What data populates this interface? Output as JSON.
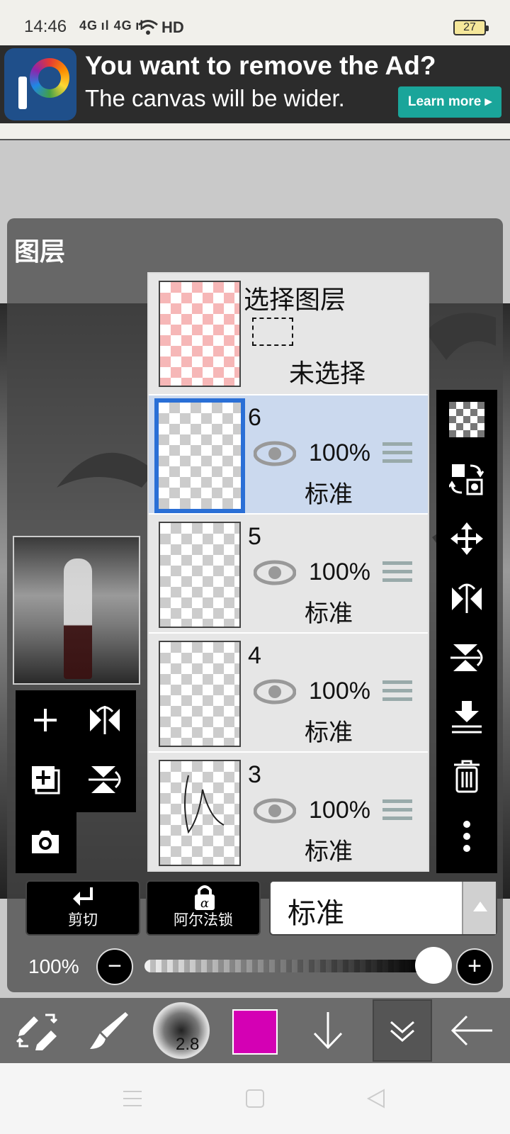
{
  "status": {
    "time": "14:46",
    "signal": "4G ıl 4G ıl",
    "network": "HD",
    "battery": "27"
  },
  "ad": {
    "title": "You want to remove the Ad?",
    "subtitle": "The canvas will be wider.",
    "button": "Learn more ▸"
  },
  "panel": {
    "title": "图层",
    "selection": {
      "title": "选择图层",
      "status": "未选择"
    },
    "layers": [
      {
        "number": "6",
        "opacity": "100%",
        "mode": "标准",
        "active": true
      },
      {
        "number": "5",
        "opacity": "100%",
        "mode": "标准",
        "active": false
      },
      {
        "number": "4",
        "opacity": "100%",
        "mode": "标准",
        "active": false
      },
      {
        "number": "3",
        "opacity": "100%",
        "mode": "标准",
        "active": false
      }
    ]
  },
  "blend": {
    "clip_label": "剪切",
    "alpha_lock_label": "阿尔法锁",
    "mode_value": "标准"
  },
  "opacity": {
    "value": "100%",
    "minus": "−",
    "plus": "+",
    "level": 1.0
  },
  "toolbar": {
    "brush_size": "2.8",
    "color": "#d400b4"
  }
}
